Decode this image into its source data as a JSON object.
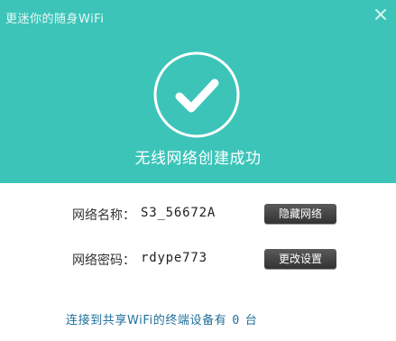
{
  "window": {
    "title": "更迷你的随身WiFi",
    "close_label": "×"
  },
  "status": {
    "icon": "check-circle-icon",
    "message": "无线网络创建成功"
  },
  "network": {
    "name_label": "网络名称：",
    "name_value": "S3_56672A",
    "hide_button": "隐藏网络",
    "password_label": "网络密码：",
    "password_value": "rdype773",
    "settings_button": "更改设置"
  },
  "footer": {
    "prefix": "连接到共享WiFi的终端设备有",
    "count": "0",
    "suffix": "台"
  },
  "colors": {
    "header_bg": "#3cc4b9",
    "button_bg": "#444444",
    "footer_text": "#1f6f9a"
  }
}
